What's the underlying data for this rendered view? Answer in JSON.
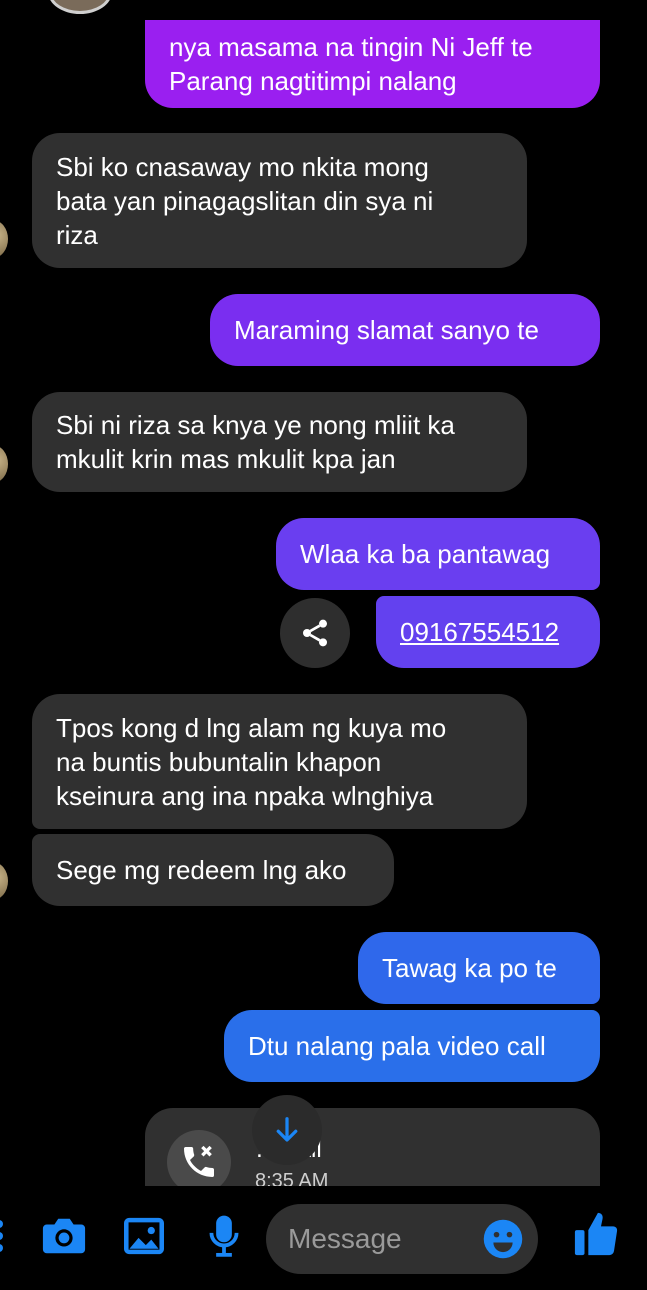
{
  "messages": {
    "m1": "nya masama na tingin Ni Jeff te\nParang nagtitimpi nalang",
    "m2": "Sbi ko cnasaway mo nkita mong\nbata yan pinagagslitan din sya ni\nriza",
    "m3": "Maraming slamat sanyo te",
    "m4": "Sbi ni riza sa knya ye nong mliit ka\nmkulit krin mas mkulit kpa jan",
    "m5": "Wlaa ka ba pantawag",
    "m6": "09167554512",
    "m7": "Tpos kong d lng alam ng kuya mo\nna buntis bubuntalin khapon\nkseinura ang ina npaka wlnghiya",
    "m8": "Sege mg redeem lng ako",
    "m9": "Tawag ka po te",
    "m10": "Dtu nalang pala video call"
  },
  "call_card": {
    "title": "… call",
    "time": "8:35 AM",
    "icon": "missed-call-icon"
  },
  "composer": {
    "placeholder": "Message",
    "icons": [
      "camera-icon",
      "gallery-icon",
      "microphone-icon",
      "emoji-icon",
      "thumbs-up-icon"
    ]
  },
  "colors": {
    "background": "#000000",
    "received_bubble": "#303030",
    "sent_purple": "#9a1ff0",
    "sent_violet": "#6a3ef0",
    "sent_blue": "#2f6fe8",
    "accent": "#1b86f5"
  }
}
